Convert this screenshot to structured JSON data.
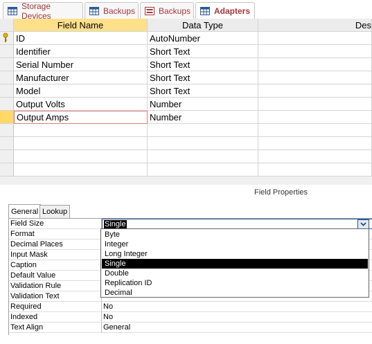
{
  "tabs": [
    {
      "label": "Storage Devices",
      "active": false,
      "icon": "table-icon"
    },
    {
      "label": "Backups",
      "active": false,
      "icon": "table-icon"
    },
    {
      "label": "Backups",
      "active": false,
      "icon": "form-icon"
    },
    {
      "label": "Adapters",
      "active": true,
      "icon": "table-icon"
    }
  ],
  "grid": {
    "headers": {
      "field_name": "Field Name",
      "data_type": "Data Type",
      "description": "Des"
    },
    "rows": [
      {
        "field": "ID",
        "type": "AutoNumber",
        "primary_key": true
      },
      {
        "field": "Identifier",
        "type": "Short Text"
      },
      {
        "field": "Serial Number",
        "type": "Short Text"
      },
      {
        "field": "Manufacturer",
        "type": "Short Text"
      },
      {
        "field": "Model",
        "type": "Short Text"
      },
      {
        "field": "Output Volts",
        "type": "Number"
      },
      {
        "field": "Output Amps",
        "type": "Number",
        "selected": true
      }
    ]
  },
  "field_properties": {
    "title": "Field Properties",
    "tabs": [
      {
        "label": "General",
        "active": true
      },
      {
        "label": "Lookup",
        "active": false
      }
    ],
    "rows": [
      {
        "name": "Field Size",
        "value": "Single"
      },
      {
        "name": "Format",
        "value": ""
      },
      {
        "name": "Decimal Places",
        "value": ""
      },
      {
        "name": "Input Mask",
        "value": ""
      },
      {
        "name": "Caption",
        "value": ""
      },
      {
        "name": "Default Value",
        "value": ""
      },
      {
        "name": "Validation Rule",
        "value": ""
      },
      {
        "name": "Validation Text",
        "value": ""
      },
      {
        "name": "Required",
        "value": "No"
      },
      {
        "name": "Indexed",
        "value": "No"
      },
      {
        "name": "Text Align",
        "value": "General"
      }
    ],
    "dropdown": {
      "options": [
        "Byte",
        "Integer",
        "Long Integer",
        "Single",
        "Double",
        "Replication ID",
        "Decimal"
      ],
      "selected": "Single"
    }
  },
  "colors": {
    "tab_text": "#a4373a",
    "selected_row": "#ffd966",
    "focus_border": "#e07b7b",
    "highlight": "#000000"
  }
}
